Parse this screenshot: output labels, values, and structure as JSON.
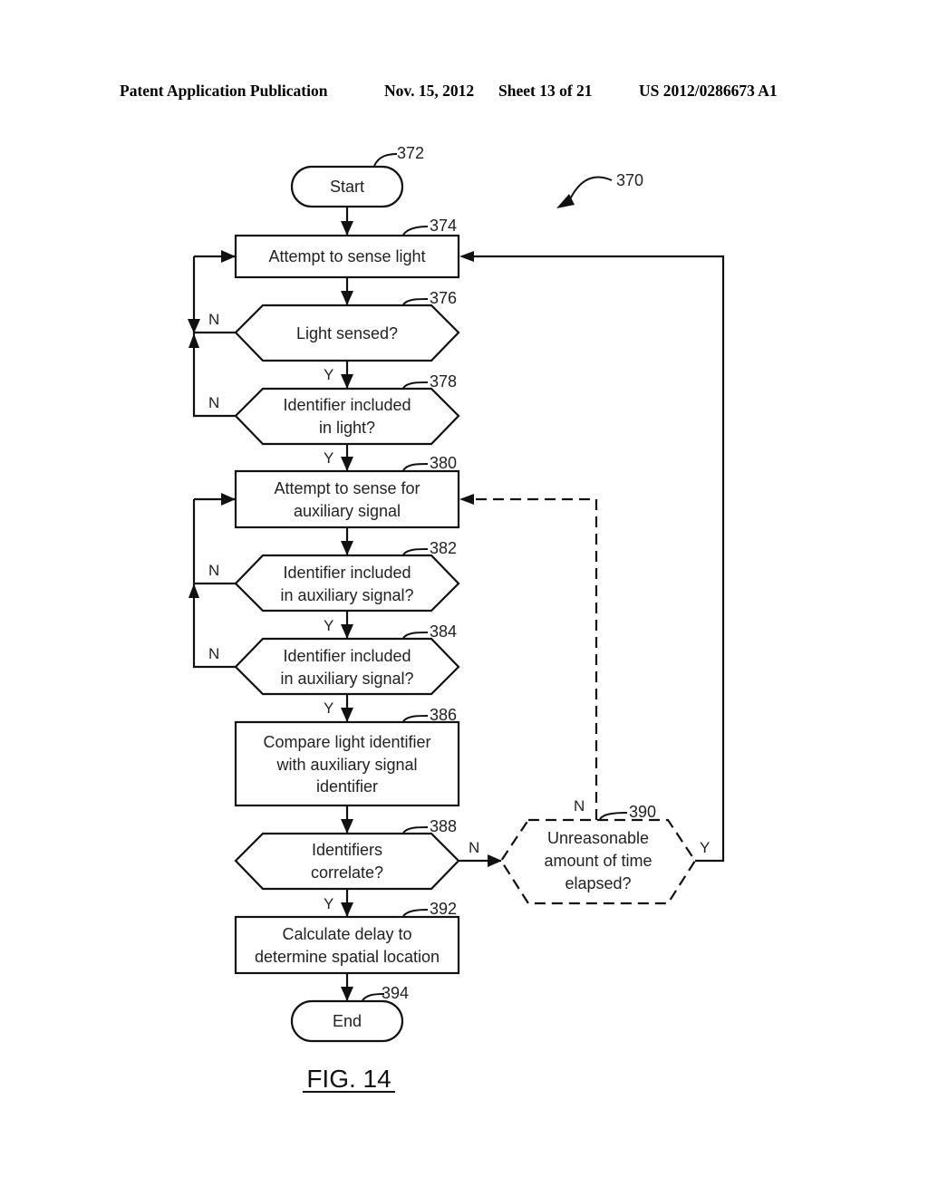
{
  "header": {
    "publication": "Patent Application Publication",
    "date": "Nov. 15, 2012",
    "sheet": "Sheet 13 of 21",
    "number": "US 2012/0286673 A1"
  },
  "figure": {
    "label": "FIG. 14",
    "ref": "370"
  },
  "nodes": {
    "start": {
      "ref": "372",
      "lines": [
        "Start"
      ]
    },
    "n374": {
      "ref": "374",
      "lines": [
        "Attempt to sense light"
      ]
    },
    "n376": {
      "ref": "376",
      "lines": [
        "Light sensed?"
      ]
    },
    "n378": {
      "ref": "378",
      "lines": [
        "Identifier included",
        "in light?"
      ]
    },
    "n380": {
      "ref": "380",
      "lines": [
        "Attempt to sense for",
        "auxiliary signal"
      ]
    },
    "n382": {
      "ref": "382",
      "lines": [
        "Identifier included",
        "in auxiliary signal?"
      ]
    },
    "n384": {
      "ref": "384",
      "lines": [
        "Identifier included",
        "in auxiliary signal?"
      ]
    },
    "n386": {
      "ref": "386",
      "lines": [
        "Compare light identifier",
        "with auxiliary signal",
        "identifier"
      ]
    },
    "n388": {
      "ref": "388",
      "lines": [
        "Identifiers",
        "correlate?"
      ]
    },
    "n390": {
      "ref": "390",
      "lines": [
        "Unreasonable",
        "amount of time",
        "elapsed?"
      ]
    },
    "n392": {
      "ref": "392",
      "lines": [
        "Calculate delay to",
        "determine spatial location"
      ]
    },
    "end": {
      "ref": "394",
      "lines": [
        "End"
      ]
    }
  },
  "branch_labels": {
    "yes": "Y",
    "no": "N"
  }
}
